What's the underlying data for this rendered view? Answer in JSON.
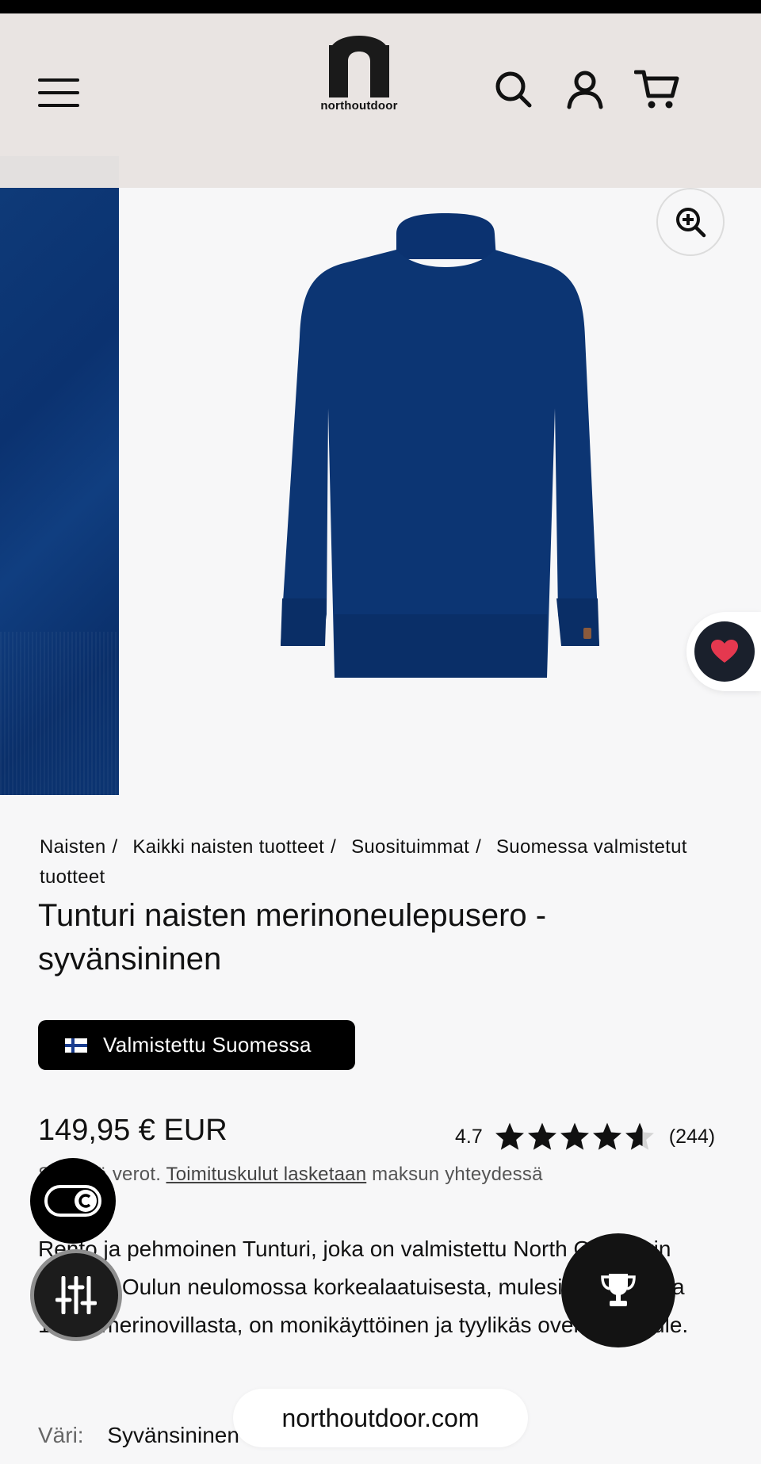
{
  "header": {
    "brand": "northoutdoor"
  },
  "icons": {
    "menu": "hamburger-icon",
    "search": "search-icon",
    "account": "user-icon",
    "cart": "cart-icon",
    "zoom": "zoom-in-icon",
    "wishlist": "heart-icon",
    "toggle": "toggle-icon",
    "filters": "sliders-icon",
    "rewards": "trophy-icon"
  },
  "colors": {
    "header_bg": "#e9e4e2",
    "product": "#0b3270",
    "wish_heart": "#e5384f",
    "badge_bg": "#000000"
  },
  "breadcrumb": [
    "Naisten",
    "Kaikki naisten tuotteet",
    "Suosituimmat",
    "Suomessa valmistetut tuotteet"
  ],
  "product": {
    "title": "Tunturi naisten merinoneulepusero - syvänsininen",
    "badge": "Valmistettu Suomessa",
    "price": "149,95 € EUR",
    "rating": "4.7",
    "rating_value": 4.7,
    "review_count": "(244)",
    "tax_prefix": "Sisältää verot.",
    "shipping_link": "Toimituskulut lasketaan",
    "tax_suffix": "maksun yhteydessä",
    "description": "Rento ja pehmoinen Tunturi, joka on valmistettu North Outdoorin omassa Oulun neulomossa korkealaatuisesta, mulesing-vapaasta 100% merinovillasta, on monikäyttöinen ja tyylikäs oversize-neule.",
    "color_label": "Väri:",
    "color_value": "Syvänsininen"
  },
  "browser": {
    "url": "northoutdoor.com"
  }
}
